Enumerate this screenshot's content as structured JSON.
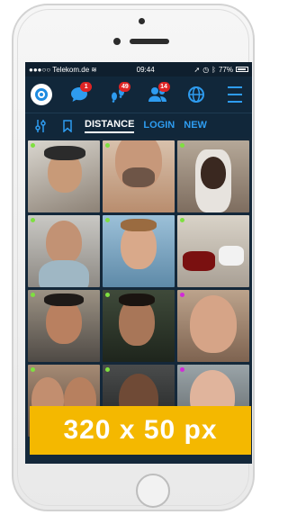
{
  "status_bar": {
    "carrier": "●●●○○ Telekom.de",
    "time": "09:44",
    "battery": "77%"
  },
  "nav": {
    "chat_badge": "1",
    "visits_badge": "49",
    "friends_badge": "14"
  },
  "tabs": {
    "distance": "DISTANCE",
    "login": "LOGIN",
    "new": "NEW"
  },
  "tiles": [
    {
      "line1": "",
      "line2": "",
      "dot": "#7ee040"
    },
    {
      "line1": "",
      "line2": "",
      "dot": "#7ee040"
    },
    {
      "line1": "",
      "line2": "",
      "dot": "#7ee040"
    },
    {
      "line1": "",
      "line2": "",
      "dot": "#7ee040"
    },
    {
      "line1": "",
      "line2": "",
      "dot": "#7ee040"
    },
    {
      "line1": "",
      "line2": "",
      "dot": "#7ee040"
    },
    {
      "line1": "",
      "line2": "",
      "dot": "#7ee040"
    },
    {
      "line1": "",
      "line2": "",
      "dot": "#7ee040"
    },
    {
      "line1": "",
      "line2": "",
      "dot": "#d22ad8"
    },
    {
      "line1": "",
      "line2": "",
      "dot": "#7ee040"
    },
    {
      "line1": "",
      "line2": "",
      "dot": "#7ee040"
    },
    {
      "line1": "",
      "line2": "",
      "dot": "#d22ad8"
    }
  ],
  "ad": {
    "label": "320 x 50 px"
  },
  "colors": {
    "accent": "#2e9cf0",
    "badge": "#e02424",
    "ad_bg": "#f4b800",
    "screen_bg": "#14283a"
  }
}
